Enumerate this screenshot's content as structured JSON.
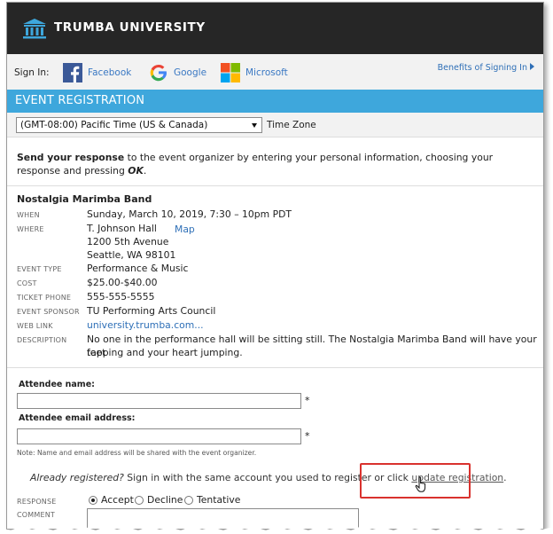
{
  "header": {
    "brand": "TRUMBA UNIVERSITY"
  },
  "signin": {
    "label": "Sign In:",
    "providers": [
      {
        "name": "Facebook"
      },
      {
        "name": "Google"
      },
      {
        "name": "Microsoft"
      }
    ],
    "benefits": "Benefits of Signing In"
  },
  "registration": {
    "bar_title": "EVENT REGISTRATION",
    "timezone_value": "(GMT-08:00) Pacific Time (US & Canada)",
    "timezone_label": "Time Zone"
  },
  "instruction": {
    "bold_part": "Send your response",
    "text_part": " to the event organizer by entering your personal information, choosing your response and pressing ",
    "ok": "OK",
    "end": "."
  },
  "event": {
    "title": "Nostalgia Marimba Band",
    "when_label": "WHEN",
    "when": "Sunday, March 10, 2019, 7:30 – 10pm PDT",
    "where_label": "WHERE",
    "where_line1": "T. Johnson Hall",
    "where_line2": "1200 5th Avenue",
    "where_line3": "Seattle, WA 98101",
    "map": "Map",
    "type_label": "EVENT TYPE",
    "type": "Performance & Music",
    "cost_label": "COST",
    "cost": "$25.00-$40.00",
    "phone_label": "TICKET PHONE",
    "phone": "555-555-5555",
    "sponsor_label": "EVENT SPONSOR",
    "sponsor": "TU Performing Arts Council",
    "web_label": "WEB LINK",
    "web": "university.trumba.com...",
    "desc_label": "DESCRIPTION",
    "desc_line1": "No one in the performance hall will be sitting still. The Nostalgia Marimba Band will have your feet",
    "desc_line2": "tapping and your heart jumping."
  },
  "form": {
    "name_label": "Attendee name:",
    "email_label": "Attendee email address:",
    "required": "*",
    "note": "Note: Name and email address will be shared with the event organizer.",
    "already_italic": "Already registered?",
    "already_text": " Sign in with the same account you used to register or click ",
    "update_link": "update registration",
    "already_end": ".",
    "response_label": "RESPONSE",
    "responses": [
      "Accept",
      "Decline",
      "Tentative"
    ],
    "comment_label": "COMMENT"
  },
  "colors": {
    "header_bg": "#262626",
    "accent_bar": "#3ea7dc",
    "link": "#2e6fb7",
    "highlight": "#d9322e"
  }
}
